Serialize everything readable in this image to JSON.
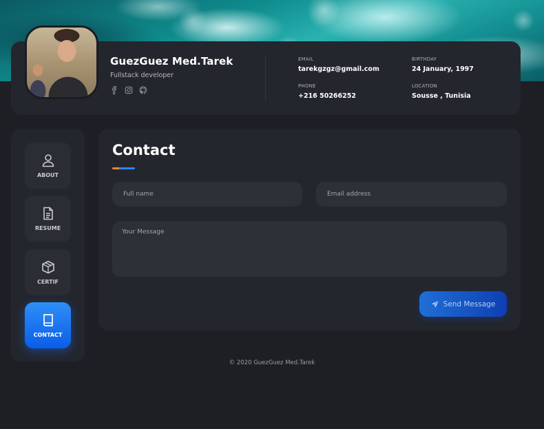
{
  "profile": {
    "name": "GuezGuez Med.Tarek",
    "role": "Fullstack developer",
    "socials": [
      "facebook-icon",
      "instagram-icon",
      "github-icon"
    ],
    "info": {
      "email_label": "EMAIL",
      "email": "tarekgzgz@gmail.com",
      "birthday_label": "BIRTHDAY",
      "birthday": "24 January, 1997",
      "phone_label": "PHONE",
      "phone": "+216 50266252",
      "location_label": "LOCATION",
      "location": "Sousse , Tunisia"
    }
  },
  "nav": {
    "items": [
      {
        "label": "ABOUT",
        "icon": "user-icon",
        "active": false
      },
      {
        "label": "RESUME",
        "icon": "document-icon",
        "active": false
      },
      {
        "label": "CERTIF",
        "icon": "box-icon",
        "active": false
      },
      {
        "label": "CONTACT",
        "icon": "book-icon",
        "active": true
      }
    ]
  },
  "contact": {
    "title": "Contact",
    "fullname_placeholder": "Full name",
    "email_placeholder": "Email address",
    "message_placeholder": "Your Message",
    "send_label": "Send Message"
  },
  "footer": {
    "text": "© 2020 GuezGuez Med.Tarek"
  },
  "colors": {
    "background": "#1e1f25",
    "card": "#24262d",
    "accent_blue": "#2d86f2",
    "accent_orange": "#f0833a"
  }
}
